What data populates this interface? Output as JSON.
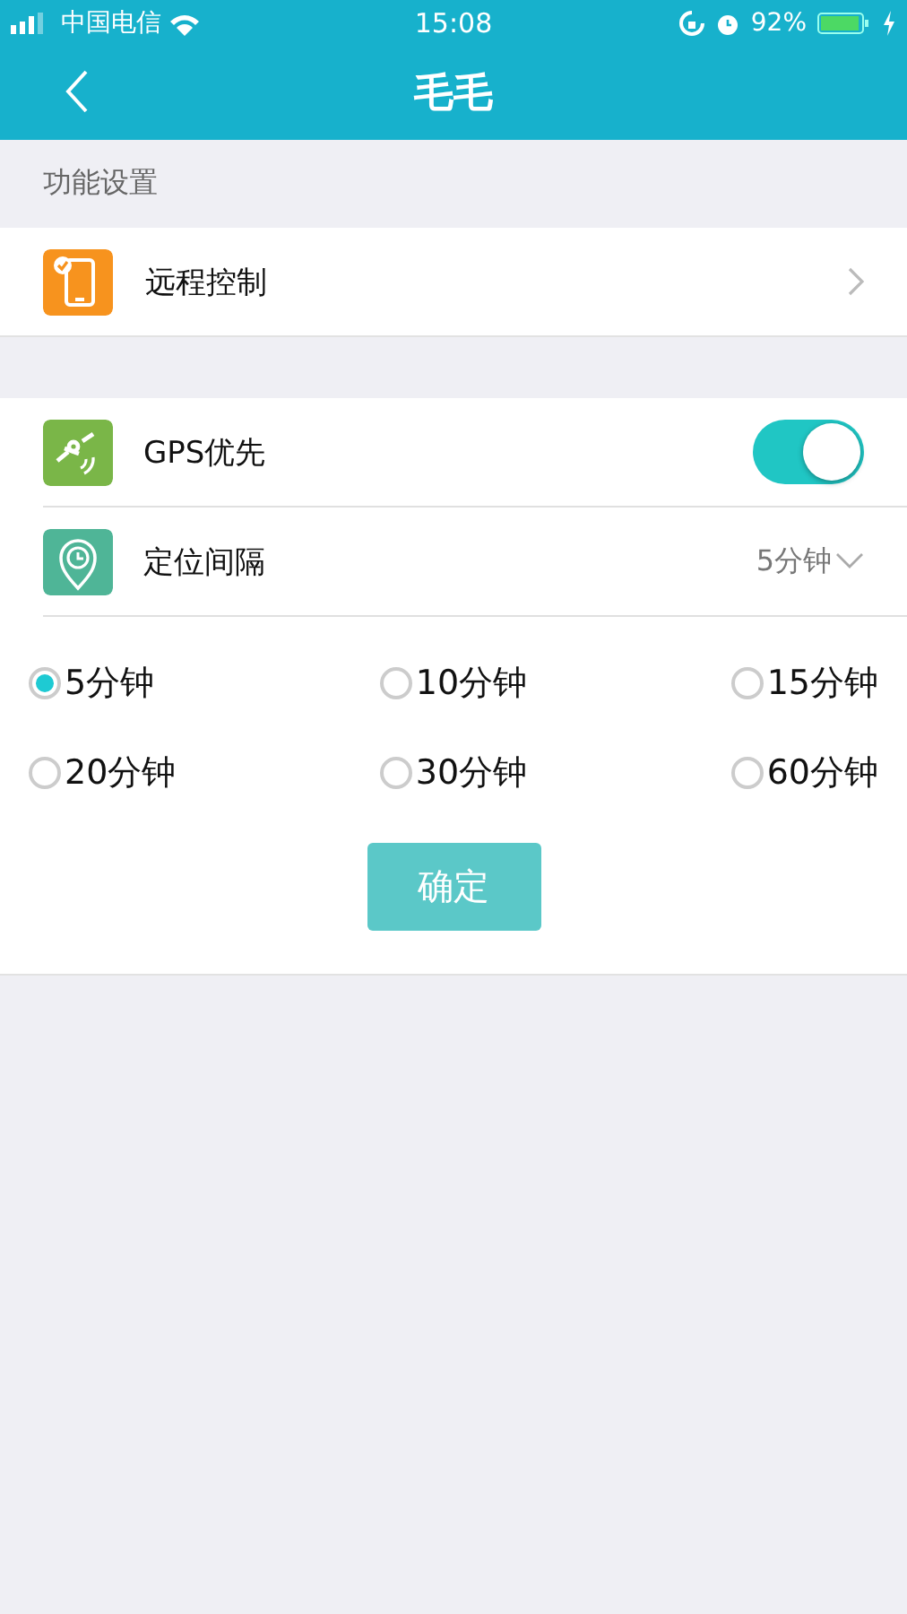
{
  "status_bar": {
    "carrier": "中国电信",
    "time": "15:08",
    "battery": "92%"
  },
  "nav": {
    "title": "毛毛"
  },
  "section_header": "功能设置",
  "remote_control": {
    "label": "远程控制"
  },
  "gps": {
    "label": "GPS优先",
    "on": true
  },
  "interval": {
    "label": "定位间隔",
    "value": "5分钟",
    "expanded": true
  },
  "options": [
    {
      "label": "5分钟",
      "selected": true
    },
    {
      "label": "10分钟",
      "selected": false
    },
    {
      "label": "15分钟",
      "selected": false
    },
    {
      "label": "20分钟",
      "selected": false
    },
    {
      "label": "30分钟",
      "selected": false
    },
    {
      "label": "60分钟",
      "selected": false
    }
  ],
  "confirm_button": "确定"
}
